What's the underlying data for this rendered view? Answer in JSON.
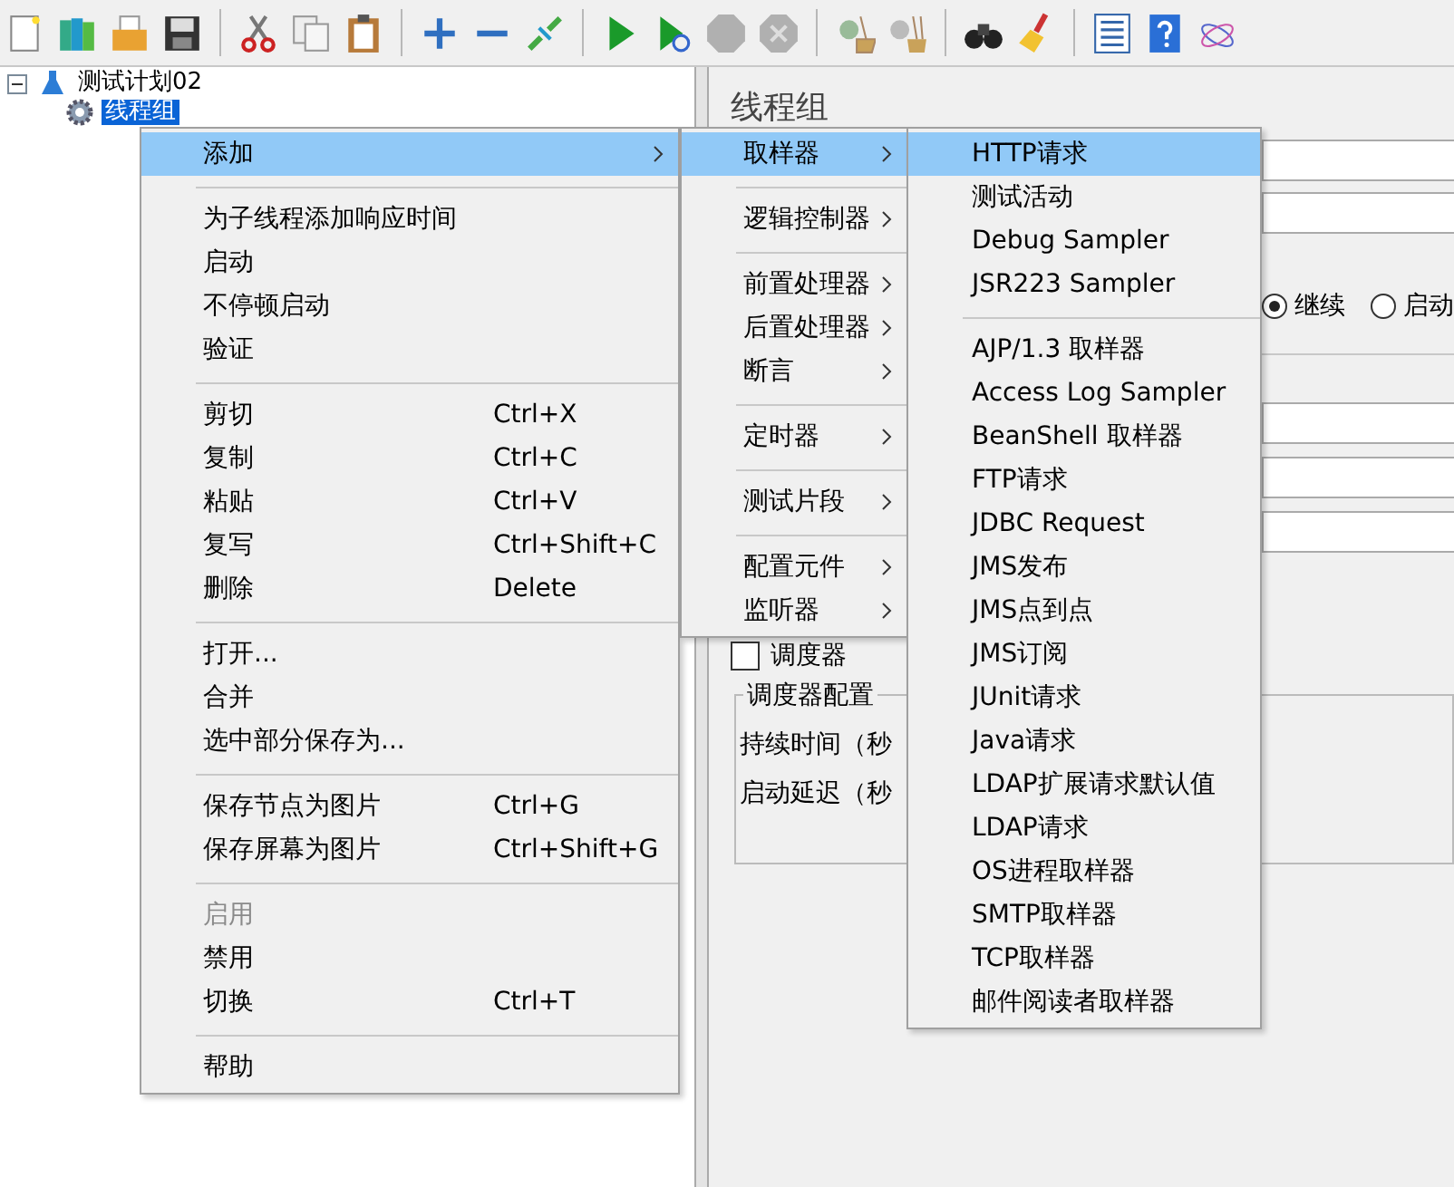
{
  "tree": {
    "items": [
      {
        "label": "测试计划02",
        "expanded": true,
        "selected": false,
        "children": [
          {
            "label": "线程组",
            "selected": true
          }
        ]
      }
    ]
  },
  "panel": {
    "title": "线程组",
    "radios": [
      {
        "label": "继续",
        "selected": true
      },
      {
        "label": "启动",
        "selected": false
      }
    ],
    "scheduler": {
      "label": "调度器",
      "checked": false
    },
    "scheduler_config": {
      "title": "调度器配置",
      "rows": [
        "持续时间（秒",
        "启动延迟（秒"
      ]
    }
  },
  "context_menu": {
    "groups": [
      [
        {
          "label": "添加",
          "submenu": true,
          "selected": true,
          "disabled": false
        }
      ],
      [
        {
          "label": "为子线程添加响应时间",
          "selected": false,
          "disabled": false
        },
        {
          "label": "启动",
          "selected": false,
          "disabled": false
        },
        {
          "label": "不停顿启动",
          "selected": false,
          "disabled": false
        },
        {
          "label": "验证",
          "selected": false,
          "disabled": false
        }
      ],
      [
        {
          "label": "剪切",
          "shortcut": "Ctrl+X",
          "selected": false,
          "disabled": false
        },
        {
          "label": "复制",
          "shortcut": "Ctrl+C",
          "selected": false,
          "disabled": false
        },
        {
          "label": "粘贴",
          "shortcut": "Ctrl+V",
          "selected": false,
          "disabled": false
        },
        {
          "label": "复写",
          "shortcut": "Ctrl+Shift+C",
          "selected": false,
          "disabled": false
        },
        {
          "label": "删除",
          "shortcut": "Delete",
          "selected": false,
          "disabled": false
        }
      ],
      [
        {
          "label": "打开...",
          "selected": false,
          "disabled": false
        },
        {
          "label": "合并",
          "selected": false,
          "disabled": false
        },
        {
          "label": "选中部分保存为...",
          "selected": false,
          "disabled": false
        }
      ],
      [
        {
          "label": "保存节点为图片",
          "shortcut": "Ctrl+G",
          "selected": false,
          "disabled": false
        },
        {
          "label": "保存屏幕为图片",
          "shortcut": "Ctrl+Shift+G",
          "selected": false,
          "disabled": false
        }
      ],
      [
        {
          "label": "启用",
          "selected": false,
          "disabled": true
        },
        {
          "label": "禁用",
          "selected": false,
          "disabled": false
        },
        {
          "label": "切换",
          "shortcut": "Ctrl+T",
          "selected": false,
          "disabled": false
        }
      ],
      [
        {
          "label": "帮助",
          "selected": false,
          "disabled": false
        }
      ]
    ]
  },
  "submenu": {
    "groups": [
      [
        {
          "label": "取样器",
          "selected": true
        }
      ],
      [
        {
          "label": "逻辑控制器",
          "selected": false
        }
      ],
      [
        {
          "label": "前置处理器",
          "selected": false
        },
        {
          "label": "后置处理器",
          "selected": false
        },
        {
          "label": "断言",
          "selected": false
        }
      ],
      [
        {
          "label": "定时器",
          "selected": false
        }
      ],
      [
        {
          "label": "测试片段",
          "selected": false
        }
      ],
      [
        {
          "label": "配置元件",
          "selected": false
        },
        {
          "label": "监听器",
          "selected": false
        }
      ]
    ]
  },
  "sampler_menu": {
    "groups": [
      [
        {
          "label": "HTTP请求",
          "selected": true
        },
        {
          "label": "测试活动",
          "selected": false
        },
        {
          "label": "Debug Sampler",
          "selected": false
        },
        {
          "label": "JSR223 Sampler",
          "selected": false
        }
      ],
      [
        {
          "label": "AJP/1.3 取样器",
          "selected": false
        },
        {
          "label": "Access Log Sampler",
          "selected": false
        },
        {
          "label": "BeanShell 取样器",
          "selected": false
        },
        {
          "label": "FTP请求",
          "selected": false
        },
        {
          "label": "JDBC Request",
          "selected": false
        },
        {
          "label": "JMS发布",
          "selected": false
        },
        {
          "label": "JMS点到点",
          "selected": false
        },
        {
          "label": "JMS订阅",
          "selected": false
        },
        {
          "label": "JUnit请求",
          "selected": false
        },
        {
          "label": "Java请求",
          "selected": false
        },
        {
          "label": "LDAP扩展请求默认值",
          "selected": false
        },
        {
          "label": "LDAP请求",
          "selected": false
        },
        {
          "label": "OS进程取样器",
          "selected": false
        },
        {
          "label": "SMTP取样器",
          "selected": false
        },
        {
          "label": "TCP取样器",
          "selected": false
        },
        {
          "label": "邮件阅读者取样器",
          "selected": false
        }
      ]
    ]
  }
}
